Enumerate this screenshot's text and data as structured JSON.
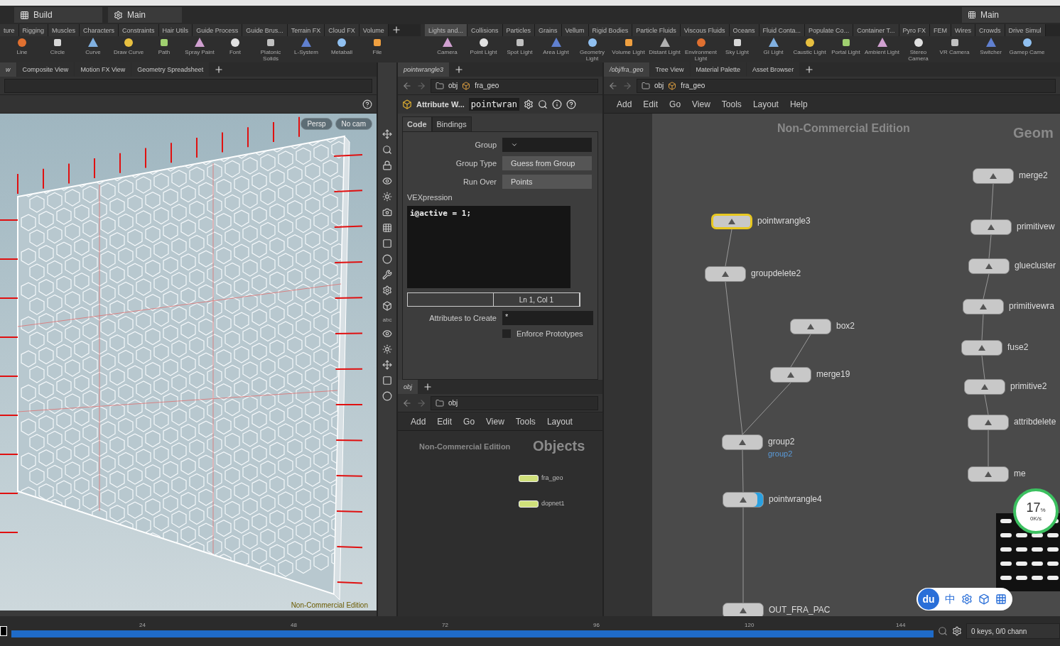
{
  "desk_bar": {
    "desktops": [
      {
        "label": "Build"
      },
      {
        "label": "Main"
      }
    ],
    "right_desktop": "Main"
  },
  "shelves": [
    {
      "tabs": [
        {
          "label": "ture",
          "selected": false
        },
        {
          "label": "Rigging",
          "selected": false
        },
        {
          "label": "Muscles",
          "selected": false
        },
        {
          "label": "Characters",
          "selected": false
        },
        {
          "label": "Constraints",
          "selected": false
        },
        {
          "label": "Hair Utils",
          "selected": false
        },
        {
          "label": "Guide Process",
          "selected": false
        },
        {
          "label": "Guide Brus...",
          "selected": false
        },
        {
          "label": "Terrain FX",
          "selected": false
        },
        {
          "label": "Cloud FX",
          "selected": false
        },
        {
          "label": "Volume",
          "selected": false
        }
      ],
      "tools": [
        "Line",
        "Circle",
        "Curve",
        "Draw Curve",
        "Path",
        "Spray Paint",
        "Font",
        "Platonic Solids",
        "L-System",
        "Metaball",
        "File"
      ]
    },
    {
      "tabs": [
        {
          "label": "Lights and...",
          "selected": true
        },
        {
          "label": "Collisions",
          "selected": false
        },
        {
          "label": "Particles",
          "selected": false
        },
        {
          "label": "Grains",
          "selected": false
        },
        {
          "label": "Vellum",
          "selected": false
        },
        {
          "label": "Rigid Bodies",
          "selected": false
        },
        {
          "label": "Particle Fluids",
          "selected": false
        },
        {
          "label": "Viscous Fluids",
          "selected": false
        },
        {
          "label": "Oceans",
          "selected": false
        },
        {
          "label": "Fluid Conta...",
          "selected": false
        },
        {
          "label": "Populate Co...",
          "selected": false
        },
        {
          "label": "Container T...",
          "selected": false
        },
        {
          "label": "Pyro FX",
          "selected": false
        },
        {
          "label": "FEM",
          "selected": false
        },
        {
          "label": "Wires",
          "selected": false
        },
        {
          "label": "Crowds",
          "selected": false
        },
        {
          "label": "Drive Simul",
          "selected": false
        }
      ],
      "tools": [
        "Camera",
        "Point Light",
        "Spot Light",
        "Area Light",
        "Geometry Light",
        "Volume Light",
        "Distant Light",
        "Environment Light",
        "Sky Light",
        "GI Light",
        "Caustic Light",
        "Portal Light",
        "Ambient Light",
        "Stereo Camera",
        "VR Camera",
        "Switcher",
        "Gamep Came"
      ]
    }
  ],
  "viewer": {
    "tabs": [
      {
        "label": "w",
        "selected": true
      },
      {
        "label": "Composite View",
        "selected": false
      },
      {
        "label": "Motion FX View",
        "selected": false
      },
      {
        "label": "Geometry Spreadsheet",
        "selected": false
      }
    ],
    "view_buttons": [
      "Persp",
      "No cam"
    ],
    "tool_label": "abc",
    "footer": "Non-Commercial Edition"
  },
  "parameters": {
    "tabs": [
      {
        "label": "pointwrangle3",
        "selected": true
      }
    ],
    "path": [
      "obj",
      "fra_geo"
    ],
    "node_type": "Attribute W...",
    "node_name": "pointwran",
    "sections": [
      {
        "label": "Code",
        "selected": true
      },
      {
        "label": "Bindings",
        "selected": false
      }
    ],
    "group": {
      "label": "Group"
    },
    "group_type": {
      "label": "Group Type",
      "value": "Guess from Group"
    },
    "run_over": {
      "label": "Run Over",
      "value": "Points"
    },
    "vexpression": {
      "label": "VEXpression",
      "code": "i@active = 1;",
      "position": "Ln 1, Col 1"
    },
    "attributes_to_create": {
      "label": "Attributes to Create",
      "value": "*"
    },
    "enforce_prototypes": {
      "label": "Enforce Prototypes",
      "checked": false
    }
  },
  "objects_network": {
    "tabs": [
      {
        "label": "obj",
        "selected": true
      }
    ],
    "path": [
      "obj"
    ],
    "menu": [
      "Add",
      "Edit",
      "Go",
      "View",
      "Tools",
      "Layout"
    ],
    "watermark": "Non-Commercial Edition",
    "context": "Objects",
    "nodes": [
      {
        "name": "fra_geo"
      },
      {
        "name": "dopnet1"
      }
    ]
  },
  "geometry_network": {
    "tabs": [
      {
        "label": "/obj/fra_geo",
        "selected": true
      },
      {
        "label": "Tree View",
        "selected": false
      },
      {
        "label": "Material Palette",
        "selected": false
      },
      {
        "label": "Asset Browser",
        "selected": false
      }
    ],
    "path": [
      "obj",
      "fra_geo"
    ],
    "menu": [
      "Add",
      "Edit",
      "Go",
      "View",
      "Tools",
      "Layout",
      "Help"
    ],
    "watermark": "Non-Commercial Edition",
    "context": "Geom",
    "nodes": [
      {
        "name": "pointwrangle3",
        "selected": true,
        "display": false
      },
      {
        "name": "groupdelete2",
        "selected": false,
        "display": false
      },
      {
        "name": "box2",
        "selected": false,
        "display": false
      },
      {
        "name": "merge19",
        "selected": false,
        "display": false
      },
      {
        "name": "group2",
        "sublabel": "group2",
        "selected": false,
        "display": false
      },
      {
        "name": "pointwrangle4",
        "selected": false,
        "display": true
      },
      {
        "name": "OUT_FRA_PAC",
        "selected": false,
        "display": false
      },
      {
        "name": "merge2",
        "selected": false,
        "display": false
      },
      {
        "name": "primitivew",
        "selected": false,
        "display": false
      },
      {
        "name": "gluecluster",
        "selected": false,
        "display": false
      },
      {
        "name": "primitivewra",
        "selected": false,
        "display": false
      },
      {
        "name": "fuse2",
        "selected": false,
        "display": false
      },
      {
        "name": "primitive2",
        "selected": false,
        "display": false
      },
      {
        "name": "attribdelete",
        "selected": false,
        "display": false
      },
      {
        "name": "me",
        "selected": false,
        "display": false
      }
    ],
    "meter": {
      "percent": "17",
      "unit": "%",
      "rate": "0K/s"
    },
    "ime_bar": {
      "logo": "du",
      "mode": "中"
    }
  },
  "timeline": {
    "ticks": [
      "24",
      "48",
      "72",
      "96",
      "120",
      "144"
    ],
    "status": "0 keys, 0/0 chann"
  }
}
